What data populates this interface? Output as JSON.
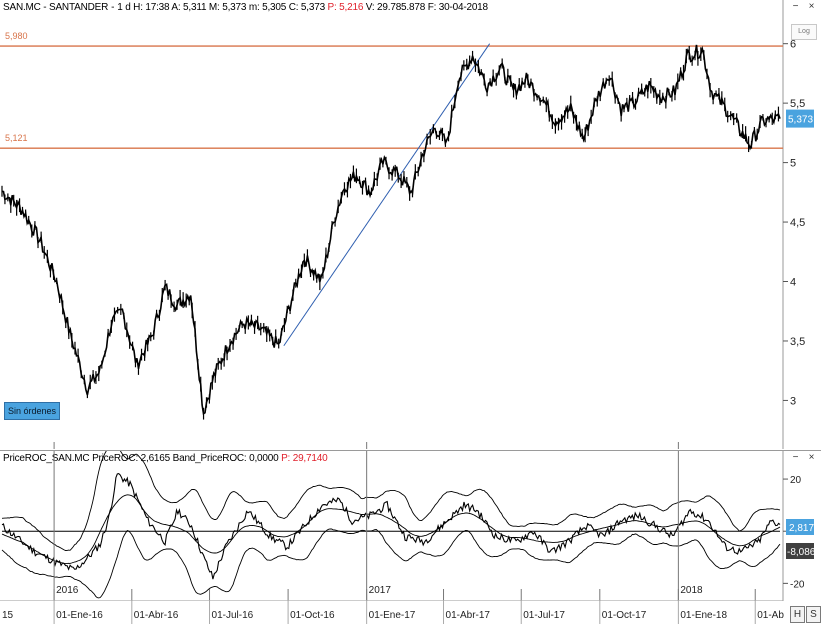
{
  "header": {
    "symbol": "SAN.MC - SANTANDER",
    "interval": "1 d",
    "h": "H: 17:38",
    "a": "A: 5,311",
    "m": "M: 5,373",
    "min": "m: 5,305",
    "c": "C: 5,373",
    "p": "P: 5,216",
    "v": "V: 29.785.878",
    "f": "F: 30-04-2018"
  },
  "roc_header": {
    "label": "PriceROC_SAN.MC",
    "value": "PriceROC: 2,6165",
    "band": "Band_PriceROC: 0,0000",
    "p": "P: 29,7140"
  },
  "buttons": {
    "minimize": "−",
    "close": "×",
    "log": "Log",
    "h_tool": "H",
    "s_tool": "S"
  },
  "order_badge": "Sin órdenes",
  "colors": {
    "price": "#000000",
    "resistance": "#d8744a",
    "trendline": "#2f5fb0",
    "last_badge": "#4aa3df",
    "roc_badge": "#4aa3df",
    "roc_badge2": "#404040"
  },
  "chart_data": [
    {
      "type": "line",
      "title": "SAN.MC - SANTANDER",
      "x_ticks": [
        "01-Ene-16",
        "01-Abr-16",
        "01-Jul-16",
        "01-Oct-16",
        "01-Ene-17",
        "01-Abr-17",
        "01-Jul-17",
        "01-Oct-17",
        "01-Ene-18",
        "01-Ab"
      ],
      "x_tick_partial_left": "15",
      "year_markers": [
        "2016",
        "2017",
        "2018"
      ],
      "y_ticks": [
        3,
        3.5,
        4,
        4.5,
        5,
        5.5,
        6
      ],
      "y_tick_labels": [
        "3",
        "3,5",
        "4",
        "4,5",
        "5",
        "5,5",
        "6"
      ],
      "ylim": [
        2.6,
        6.3
      ],
      "grid": false,
      "log_scale": false,
      "last_value": "5,373",
      "horizontal_lines": [
        {
          "value": 5.98,
          "label": "5,980"
        },
        {
          "value": 5.121,
          "label": "5,121"
        }
      ],
      "trendline": {
        "from": [
          "2016-09-26",
          3.46
        ],
        "to": [
          "2017-05-25",
          6.0
        ]
      },
      "series": [
        {
          "dates": [
            "2015-11-01",
            "2015-11-25",
            "2015-12-15",
            "2016-01-04",
            "2016-01-20",
            "2016-02-09",
            "2016-02-24",
            "2016-03-08",
            "2016-03-21",
            "2016-04-07",
            "2016-04-25",
            "2016-05-10",
            "2016-05-24",
            "2016-06-09",
            "2016-06-24",
            "2016-07-06",
            "2016-07-25",
            "2016-08-10",
            "2016-08-30",
            "2016-09-20",
            "2016-10-05",
            "2016-10-20",
            "2016-11-09",
            "2016-11-25",
            "2016-12-06",
            "2016-12-20",
            "2017-01-05",
            "2017-01-20",
            "2017-02-07",
            "2017-02-22",
            "2017-03-09",
            "2017-03-22",
            "2017-04-05",
            "2017-04-18",
            "2017-05-05",
            "2017-05-22",
            "2017-06-07",
            "2017-06-22",
            "2017-07-07",
            "2017-07-25",
            "2017-08-10",
            "2017-08-28",
            "2017-09-12",
            "2017-09-28",
            "2017-10-12",
            "2017-10-26",
            "2017-11-10",
            "2017-11-28",
            "2017-12-12",
            "2017-12-28",
            "2018-01-12",
            "2018-01-29",
            "2018-02-09",
            "2018-02-26",
            "2018-03-12",
            "2018-03-26",
            "2018-04-10",
            "2018-04-30"
          ],
          "values": [
            4.76,
            4.6,
            4.35,
            4.0,
            3.55,
            3.1,
            3.25,
            3.65,
            3.75,
            3.3,
            3.55,
            3.95,
            3.8,
            3.9,
            2.9,
            3.2,
            3.5,
            3.65,
            3.6,
            3.46,
            3.85,
            4.2,
            4.0,
            4.55,
            4.8,
            4.9,
            4.75,
            5.0,
            4.9,
            4.75,
            5.1,
            5.3,
            5.15,
            5.7,
            5.9,
            5.65,
            5.8,
            5.6,
            5.7,
            5.55,
            5.35,
            5.45,
            5.2,
            5.55,
            5.75,
            5.45,
            5.5,
            5.65,
            5.55,
            5.6,
            5.9,
            5.95,
            5.6,
            5.45,
            5.3,
            5.15,
            5.35,
            5.37
          ]
        }
      ]
    },
    {
      "type": "line",
      "title": "PriceROC_SAN.MC",
      "y_ticks": [
        -20,
        0,
        20
      ],
      "y_tick_labels": [
        "-20",
        "0",
        "20"
      ],
      "ylim": [
        -26,
        30
      ],
      "grid": false,
      "last_values": [
        "2,817",
        "-8,086"
      ],
      "series": [
        {
          "dates": [
            "2015-11-01",
            "2015-11-20",
            "2015-12-10",
            "2016-01-04",
            "2016-01-25",
            "2016-02-10",
            "2016-02-24",
            "2016-03-05",
            "2016-03-15",
            "2016-03-30",
            "2016-04-20",
            "2016-05-10",
            "2016-05-25",
            "2016-06-10",
            "2016-06-24",
            "2016-07-05",
            "2016-07-20",
            "2016-08-15",
            "2016-09-10",
            "2016-09-30",
            "2016-10-20",
            "2016-11-10",
            "2016-11-30",
            "2016-12-15",
            "2017-01-05",
            "2017-01-25",
            "2017-02-15",
            "2017-03-10",
            "2017-04-05",
            "2017-04-25",
            "2017-05-10",
            "2017-06-01",
            "2017-06-25",
            "2017-07-15",
            "2017-08-05",
            "2017-08-25",
            "2017-09-15",
            "2017-10-05",
            "2017-10-25",
            "2017-11-15",
            "2017-12-05",
            "2017-12-25",
            "2018-01-15",
            "2018-02-05",
            "2018-02-25",
            "2018-03-15",
            "2018-04-05",
            "2018-04-20",
            "2018-04-30"
          ],
          "values": [
            2,
            -3,
            -8,
            -12,
            -15,
            -10,
            -5,
            5,
            22,
            18,
            4,
            -4,
            8,
            2,
            -10,
            -18,
            -6,
            8,
            -2,
            -6,
            2,
            10,
            12,
            4,
            6,
            10,
            -2,
            -4,
            4,
            10,
            8,
            -2,
            -4,
            0,
            -8,
            -4,
            2,
            -2,
            4,
            6,
            2,
            -2,
            8,
            4,
            -6,
            -8,
            -4,
            4,
            2.6
          ]
        },
        {
          "name": "Band_PriceROC",
          "dates": [
            "2015-11-01",
            "2018-04-30"
          ],
          "values": [
            0,
            0
          ]
        }
      ]
    }
  ]
}
